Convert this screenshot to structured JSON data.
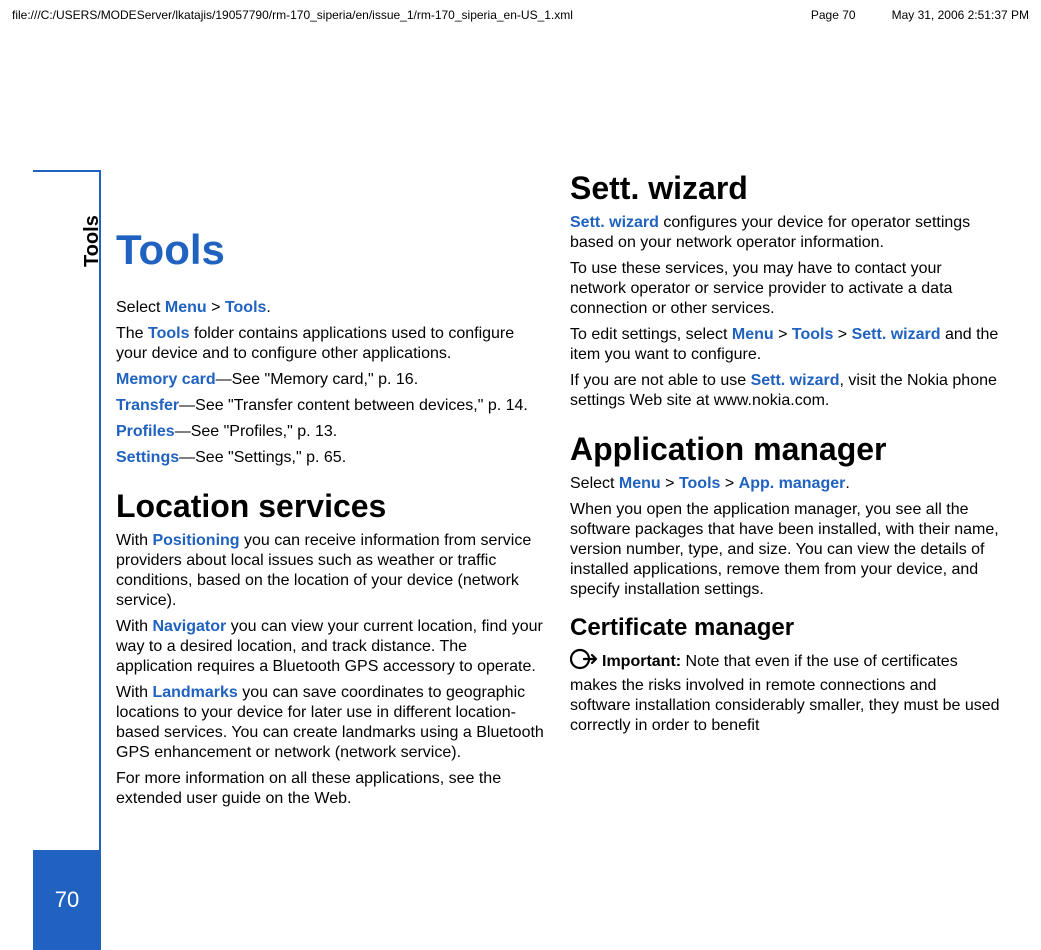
{
  "header": {
    "path": "file:///C:/USERS/MODEServer/lkatajis/19057790/rm-170_siperia/en/issue_1/rm-170_siperia_en-US_1.xml",
    "page": "Page 70",
    "datetime": "May 31, 2006 2:51:37 PM"
  },
  "sidebar": {
    "tab": "Tools",
    "pagenum": "70"
  },
  "chapter_title": "Tools",
  "col1": {
    "p1_pre": "Select ",
    "p1_menu": "Menu",
    "p1_gt": " > ",
    "p1_tools": "Tools",
    "p1_suf": ".",
    "p2_pre": "The ",
    "p2_tools": "Tools",
    "p2_suf": " folder contains applications used to configure your device and to configure other applications.",
    "mc_label": "Memory card",
    "mc_suf": "—See \"Memory card,\" p. 16.",
    "tr_label": "Transfer",
    "tr_suf": "—See \"Transfer content between devices,\" p. 14.",
    "pr_label": "Profiles",
    "pr_suf": "—See \"Profiles,\" p. 13.",
    "st_label": "Settings",
    "st_suf": "—See \"Settings,\" p. 65.",
    "h_loc": "Location services",
    "loc_p1_pre": "With ",
    "loc_p1_label": "Positioning",
    "loc_p1_suf": " you can receive information from service providers about local issues such as weather or traffic conditions, based on the location of your device (network service).",
    "loc_p2_pre": "With ",
    "loc_p2_label": "Navigator",
    "loc_p2_suf": " you can view your current location, find your way to a desired location, and track distance. The application requires a Bluetooth GPS accessory to operate.",
    "loc_p3_pre": "With ",
    "loc_p3_label": "Landmarks",
    "loc_p3_suf": " you can save coordinates to geographic locations to your device for later use in different location-based services. You can create landmarks using a Bluetooth GPS enhancement or network (network service).",
    "loc_p4": "For more information on all these applications, see the extended user guide on the Web."
  },
  "col2": {
    "h_sw": "Sett. wizard",
    "sw_p1_label": "Sett. wizard",
    "sw_p1_suf": " configures your device for operator settings based on your network operator information.",
    "sw_p2": "To use these services, you may have to contact your network operator or service provider to activate a data connection or other services.",
    "sw_p3_pre": "To edit settings, select ",
    "sw_p3_menu": "Menu",
    "sw_p3_gt": " > ",
    "sw_p3_tools": "Tools",
    "sw_p3_sw": "Sett. wizard",
    "sw_p3_suf": " and the item you want to configure.",
    "sw_p4_pre": "If you are not able to use ",
    "sw_p4_label": "Sett. wizard",
    "sw_p4_suf": ", visit the Nokia phone settings Web site at www.nokia.com.",
    "h_am": "Application manager",
    "am_p1_pre": "Select ",
    "am_p1_menu": "Menu",
    "am_p1_gt": " > ",
    "am_p1_tools": "Tools",
    "am_p1_appm": "App. manager",
    "am_p1_suf": ".",
    "am_p2": "When you open the application manager, you see all the software packages that have been installed, with their name, version number, type, and size. You can view the details of installed applications, remove them from your device, and specify installation settings.",
    "h_cm": "Certificate manager",
    "cm_imp_label": "Important:  ",
    "cm_imp_text": "Note that even if the use of certificates makes the risks involved in remote connections and software installation considerably smaller, they must be used correctly in order to benefit"
  }
}
